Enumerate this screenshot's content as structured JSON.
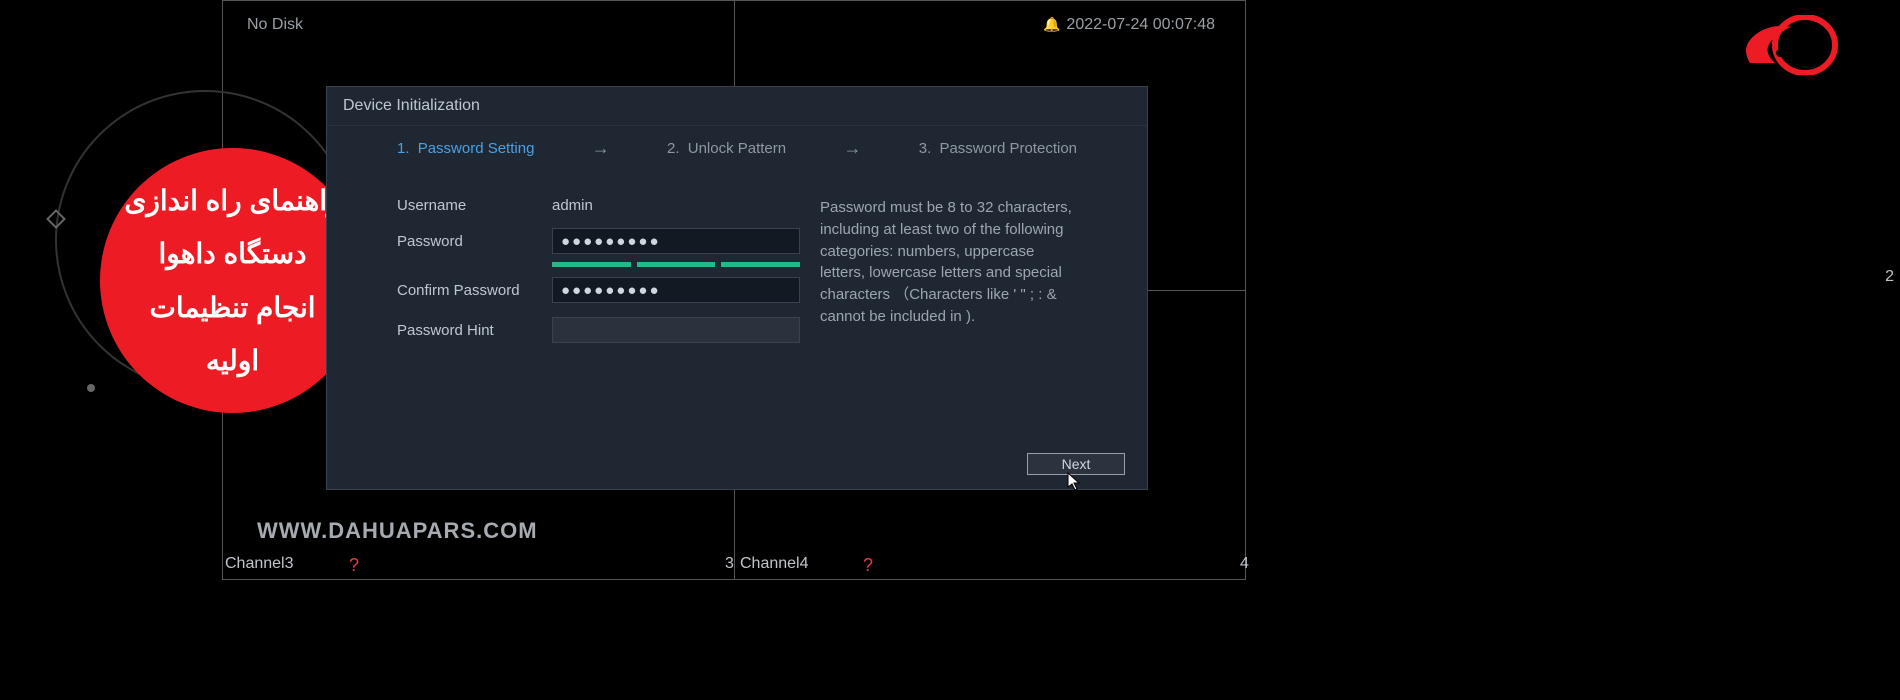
{
  "topbar": {
    "no_disk": "No Disk",
    "timestamp": "2022-07-24 00:07:48"
  },
  "channels": {
    "ch2_num": "2",
    "ch3_label": "Channel3",
    "ch3_num": "3",
    "ch4_label": "Channel4",
    "ch4_num": "4",
    "warn_glyph": "?"
  },
  "watermark": "WWW.DAHUAPARS.COM",
  "badge": {
    "line1": "راهنمای راه اندازی",
    "line2": "دستگاه داهوا",
    "line3": "انجام تنظیمات اولیه"
  },
  "dialog": {
    "title": "Device Initialization",
    "steps": [
      {
        "num": "1.",
        "label": "Password Setting"
      },
      {
        "num": "2.",
        "label": "Unlock Pattern"
      },
      {
        "num": "3.",
        "label": "Password Protection"
      }
    ],
    "arrow_glyph": "→",
    "form": {
      "username_label": "Username",
      "username_value": "admin",
      "password_label": "Password",
      "password_value": "●●●●●●●●●",
      "confirm_label": "Confirm Password",
      "confirm_value": "●●●●●●●●●",
      "hint_label": "Password Hint",
      "hint_value": ""
    },
    "rules_text": "Password must be 8 to 32 characters, including at least two of the following categories: numbers, uppercase letters, lowercase letters and special characters （Characters like ' \" ; : & cannot be included in ).",
    "next_label": "Next"
  }
}
